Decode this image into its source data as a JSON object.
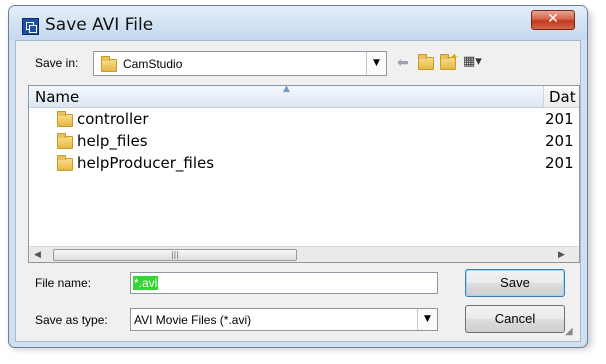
{
  "window": {
    "title": "Save AVI File",
    "close_glyph": "✕",
    "app_icon": "camstudio-app-icon"
  },
  "save_in": {
    "label": "Save in:",
    "value": "CamStudio",
    "icon": "folder-icon"
  },
  "toolbar": {
    "back_icon": "back-arrow-icon",
    "up_icon": "folder-up-icon",
    "new_folder_icon": "new-folder-icon",
    "view_menu_icon": "view-menu-icon",
    "back_glyph": "⬅",
    "up_glyph": "⤴",
    "new_folder_glyph": "✦",
    "view_glyph": "▦▾"
  },
  "file_list": {
    "columns": [
      "Name",
      "Dat"
    ],
    "sort_glyph": "▲",
    "rows": [
      {
        "name": "controller",
        "date": "201"
      },
      {
        "name": "help_files",
        "date": "201"
      },
      {
        "name": "helpProducer_files",
        "date": "201"
      }
    ]
  },
  "hscroll": {
    "left_glyph": "◀",
    "right_glyph": "▶",
    "thumb_glyph": "|||"
  },
  "file_name": {
    "label": "File name:",
    "value": "*.avi"
  },
  "save_as_type": {
    "label": "Save as type:",
    "value": "AVI Movie Files (*.avi)"
  },
  "buttons": {
    "save": "Save",
    "cancel": "Cancel"
  },
  "colors": {
    "selection": "#33d633",
    "close_button": "#c2391e",
    "title_bar": "#d2e2f3"
  }
}
